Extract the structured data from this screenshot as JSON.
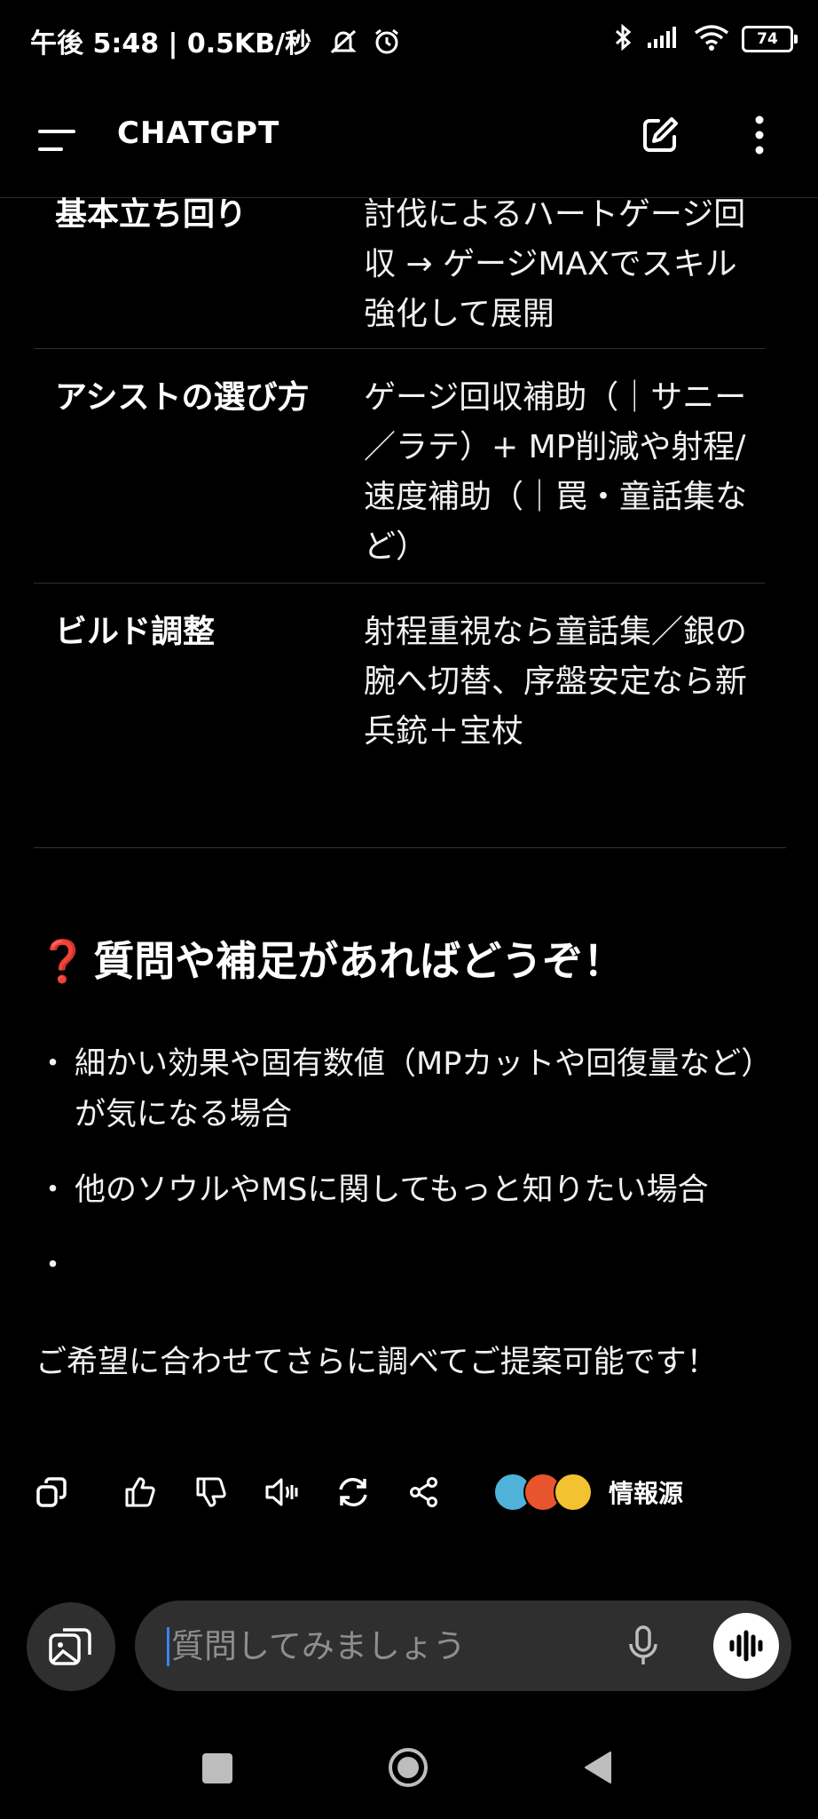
{
  "status_bar": {
    "left_text": "午後 5:48 | 0.5KB/秒",
    "battery": "74"
  },
  "header": {
    "title": "CHATGPT"
  },
  "table": {
    "rows": [
      {
        "key": "基本立ち回り",
        "value": "討伐によるハートゲージ回収 → ゲージMAXでスキル強化して展開"
      },
      {
        "key": "アシストの選び方",
        "value": "ゲージ回収補助（｜サニー／ラテ）+ MP削減や射程/速度補助（｜罠・童話集など）"
      },
      {
        "key": "ビルド調整",
        "value": "射程重視なら童話集／銀の腕へ切替、序盤安定なら新兵銃＋宝杖"
      }
    ]
  },
  "section": {
    "emoji": "❓",
    "heading": "質問や補足があればどうぞ！",
    "bullets": [
      "細かい効果や固有数値（MPカットや回復量など）が気になる場合",
      "他のソウルやMSに関してもっと知りたい場合",
      ""
    ],
    "closing": "ご希望に合わせてさらに調べてご提案可能です！"
  },
  "actions": {
    "sources_label": "情報源",
    "source_colors": [
      "#4fb3d9",
      "#e8542c",
      "#f2c230"
    ]
  },
  "composer": {
    "placeholder": "質問してみましょう"
  },
  "colors": {
    "background": "#000000",
    "surface": "#2f2f2f",
    "cursor": "#3b82f6",
    "question_mark": "#e0303a"
  }
}
